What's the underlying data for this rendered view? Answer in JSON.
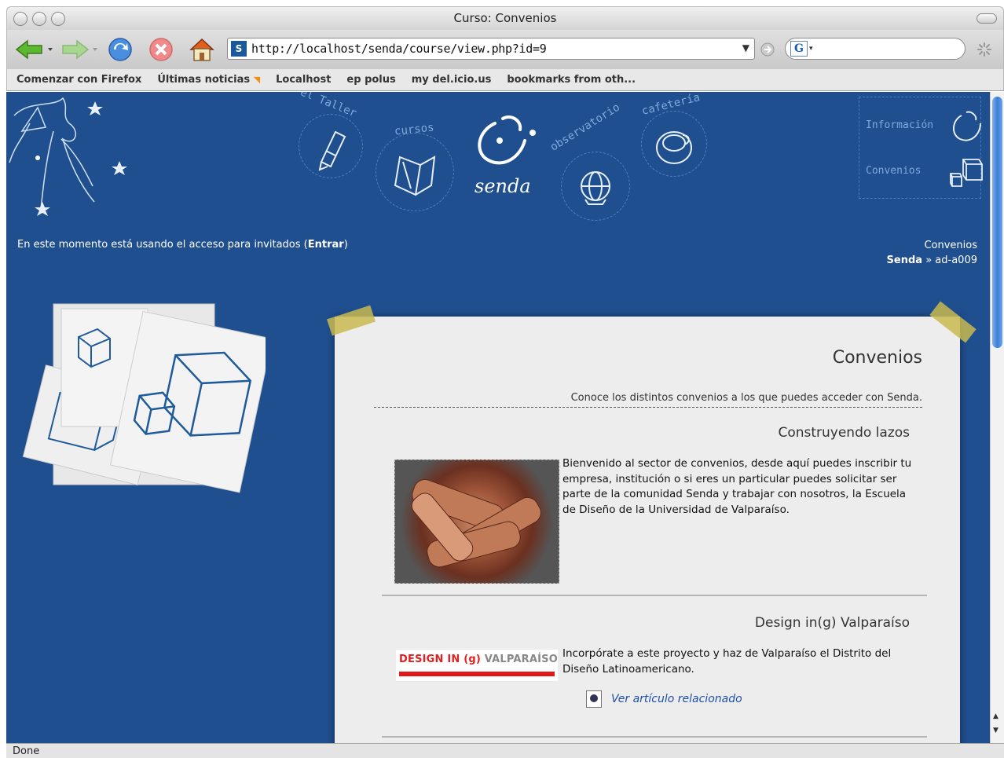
{
  "window": {
    "title": "Curso: Convenios"
  },
  "toolbar": {
    "url": "http://localhost/senda/course/view.php?id=9",
    "url_dropdown": "▼",
    "search_engine": "G"
  },
  "bookmarks": [
    "Comenzar con Firefox",
    "Últimas noticias",
    "Localhost",
    "ep polus",
    "my del.icio.us",
    "bookmarks from oth..."
  ],
  "header": {
    "nav": [
      "el Taller",
      "cursos",
      "observatorio",
      "cafetería"
    ],
    "logo": "senda",
    "side_links": [
      "Información",
      "Convenios"
    ],
    "guest_text": "En este momento está usando el acceso para invitados",
    "login_label": "Entrar",
    "page_name": "Convenios",
    "breadcrumb_home": "Senda",
    "breadcrumb_sep": "»",
    "breadcrumb_current": "ad-a009"
  },
  "card": {
    "title": "Convenios",
    "subtitle": "Conoce los distintos convenios a los que puedes acceder con Senda.",
    "sections": [
      {
        "title": "Construyendo lazos",
        "body": "Bienvenido al sector de convenios, desde aquí puedes inscribir tu empresa, institución o si eres un particular puedes solicitar ser parte de la comunidad Senda y trabajar con nosotros, la Escuela de Diseño de la Universidad de Valparaíso."
      },
      {
        "title": "Design in(g) Valparaíso",
        "logo_red": "DESIGN IN (g)",
        "logo_grey": "VALPARAÍSO",
        "body": "Incorpórate a este proyecto y haz de Valparaíso el Distrito del Diseño Latinoamericano.",
        "link": "Ver artículo relacionado"
      }
    ]
  },
  "status": {
    "text": "Done"
  },
  "colors": {
    "page_bg": "#1f4f8f",
    "card_bg": "#ededed",
    "link": "#1f4fa8"
  }
}
